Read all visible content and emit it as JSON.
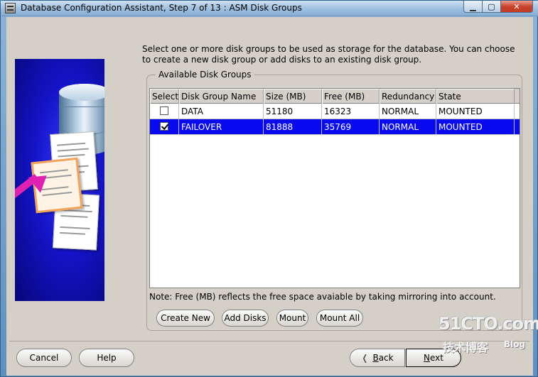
{
  "window": {
    "title": "Database Configuration Assistant, Step 7 of 13 : ASM Disk Groups",
    "controls": {
      "minimize": "▁",
      "maximize": "▢",
      "close": "✕"
    }
  },
  "instructions": "Select one or more disk groups to be used as storage for the database. You can choose to create a new disk group or add disks to an existing disk group.",
  "disk_groups": {
    "label": "Available Disk Groups",
    "columns": [
      "Select",
      "Disk Group Name",
      "Size (MB)",
      "Free (MB)",
      "Redundancy",
      "State"
    ],
    "rows": [
      {
        "selected": false,
        "name": "DATA",
        "size_mb": "51180",
        "free_mb": "16323",
        "redundancy": "NORMAL",
        "state": "MOUNTED"
      },
      {
        "selected": true,
        "name": "FAILOVER",
        "size_mb": "81888",
        "free_mb": "35769",
        "redundancy": "NORMAL",
        "state": "MOUNTED"
      }
    ],
    "note": "Note: Free (MB) reflects the free space avaiable by taking mirroring into account."
  },
  "actions": {
    "create_new": "Create New",
    "add_disks": "Add Disks",
    "mount": "Mount",
    "mount_all": "Mount All"
  },
  "footer": {
    "cancel": "Cancel",
    "help": "Help",
    "back_prefix": "",
    "back_underlined": "B",
    "back_rest": "ack",
    "next_underlined": "N",
    "next_rest": "ext"
  },
  "watermark": {
    "main": "51CTO.com",
    "sub": "技术博客",
    "blog": "Blog"
  },
  "colors": {
    "selection": "#0a0af0",
    "dialog_bg": "#d4d0c8",
    "art_blue": "#1414c8"
  }
}
